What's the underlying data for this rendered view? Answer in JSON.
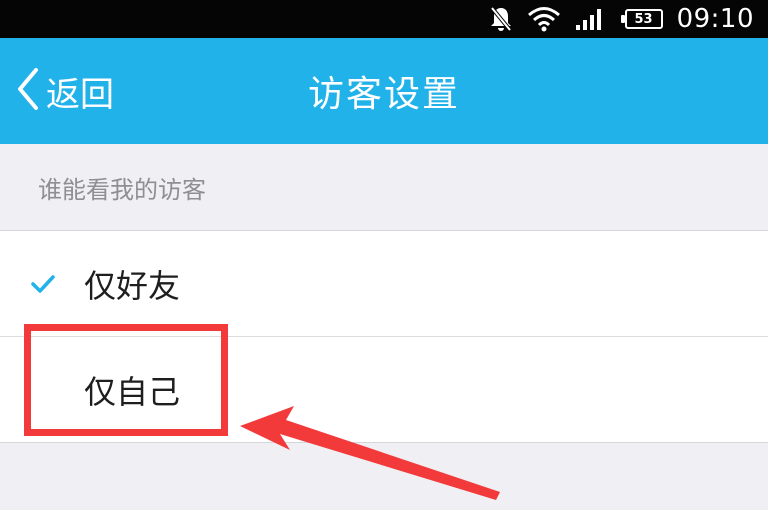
{
  "status_bar": {
    "time": "09:10",
    "battery": "53",
    "icons": [
      "notification-mute-icon",
      "wifi-icon",
      "signal-icon",
      "battery-icon"
    ],
    "colors": {
      "background": "#050505",
      "foreground": "#ffffff"
    }
  },
  "title_bar": {
    "back_label": "返回",
    "title": "访客设置",
    "colors": {
      "background": "#21b2ea",
      "text": "#ffffff"
    }
  },
  "section": {
    "header": "谁能看我的访客"
  },
  "options": [
    {
      "label": "仅好友",
      "selected": true
    },
    {
      "label": "仅自己",
      "selected": false
    }
  ],
  "annotation": {
    "highlight_color": "#f23a3a",
    "target": "仅自己"
  }
}
